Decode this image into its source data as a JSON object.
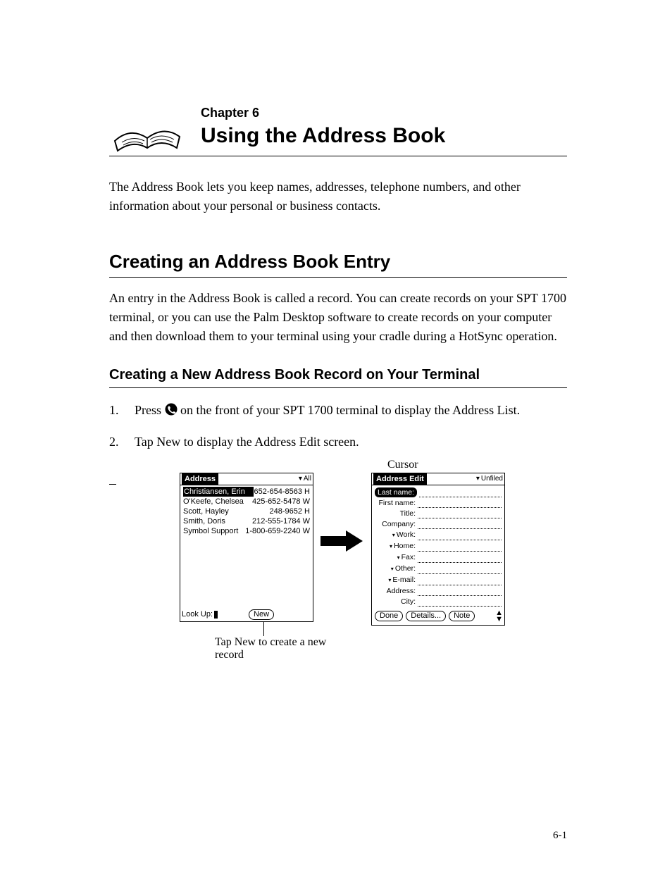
{
  "chapter": {
    "label": "Chapter 6",
    "title": "Using the Address Book"
  },
  "intro": "The Address Book lets you keep names, addresses, telephone numbers, and other information about your personal or business contacts.",
  "section": {
    "title": "Creating an Address Book Entry",
    "body": "An entry in the Address Book is called a record. You can create records on your SPT 1700 terminal, or you can use the Palm Desktop software to create records on your computer and then download them to your terminal using your cradle during a HotSync operation."
  },
  "subsection": "Creating a New Address Book Record on Your Terminal",
  "steps": [
    {
      "num": "1.",
      "before": "Press ",
      "after": " on the front of your SPT 1700 terminal to display the Address List."
    },
    {
      "num": "2.",
      "text": "Tap New to display the Address Edit screen."
    }
  ],
  "caption_cursor": "Cursor",
  "caption_new": "Tap New to create a new record",
  "palm_left": {
    "title": "Address",
    "dropdown": "All",
    "rows": [
      {
        "name": "Christiansen, Erin",
        "phone": "652-654-8563 H",
        "selected": true
      },
      {
        "name": "O'Keefe, Chelsea",
        "phone": "425-652-5478 W"
      },
      {
        "name": "Scott, Hayley",
        "phone": "248-9652 H"
      },
      {
        "name": "Smith, Doris",
        "phone": "212-555-1784 W"
      },
      {
        "name": "Symbol Support",
        "phone": "1-800-659-2240 W"
      }
    ],
    "lookup_label": "Look Up:",
    "new_button": "New"
  },
  "palm_right": {
    "title": "Address Edit",
    "dropdown": "Unfiled",
    "fields": [
      {
        "label": "Last name:",
        "selected": true
      },
      {
        "label": "First name:"
      },
      {
        "label": "Title:"
      },
      {
        "label": "Company:"
      },
      {
        "label": "Work:",
        "dropdown": true
      },
      {
        "label": "Home:",
        "dropdown": true
      },
      {
        "label": "Fax:",
        "dropdown": true
      },
      {
        "label": "Other:",
        "dropdown": true
      },
      {
        "label": "E-mail:",
        "dropdown": true
      },
      {
        "label": "Address:"
      },
      {
        "label": "City:"
      }
    ],
    "buttons": {
      "done": "Done",
      "details": "Details...",
      "note": "Note"
    }
  },
  "footer": {
    "page": "6-1"
  }
}
